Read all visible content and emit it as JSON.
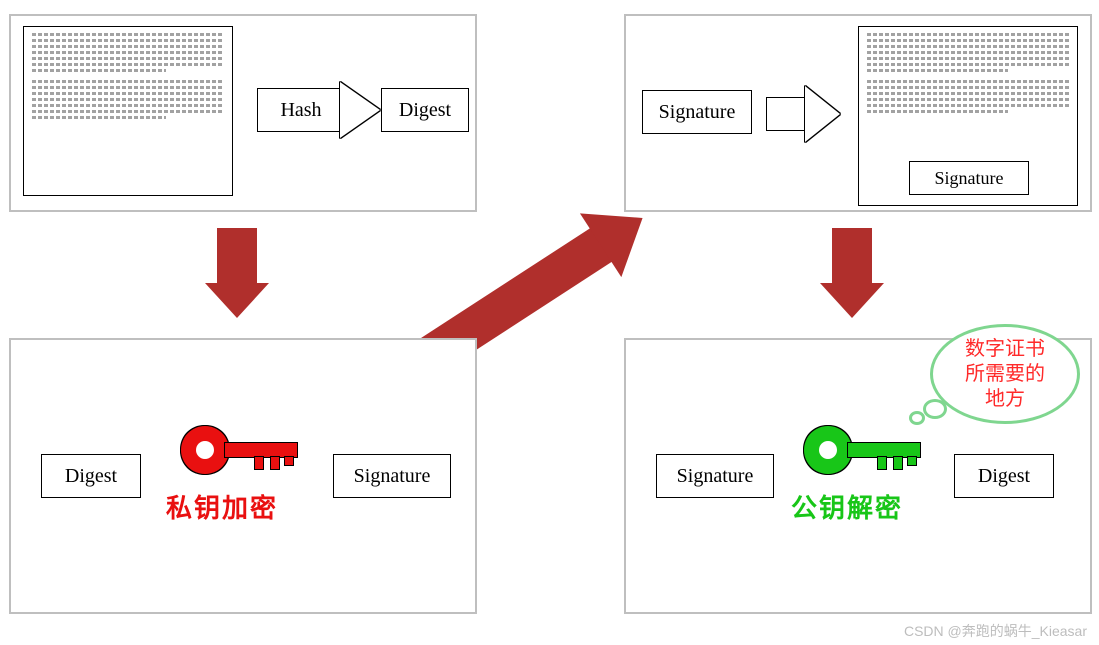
{
  "labels": {
    "hash": "Hash",
    "digest": "Digest",
    "signature": "Signature"
  },
  "captions": {
    "private_encrypt": "私钥加密",
    "public_decrypt": "公钥解密"
  },
  "speech": {
    "line1": "数字证书",
    "line2": "所需要的",
    "line3": "地方"
  },
  "watermark": "CSDN @奔跑的蜗牛_Kieasar"
}
